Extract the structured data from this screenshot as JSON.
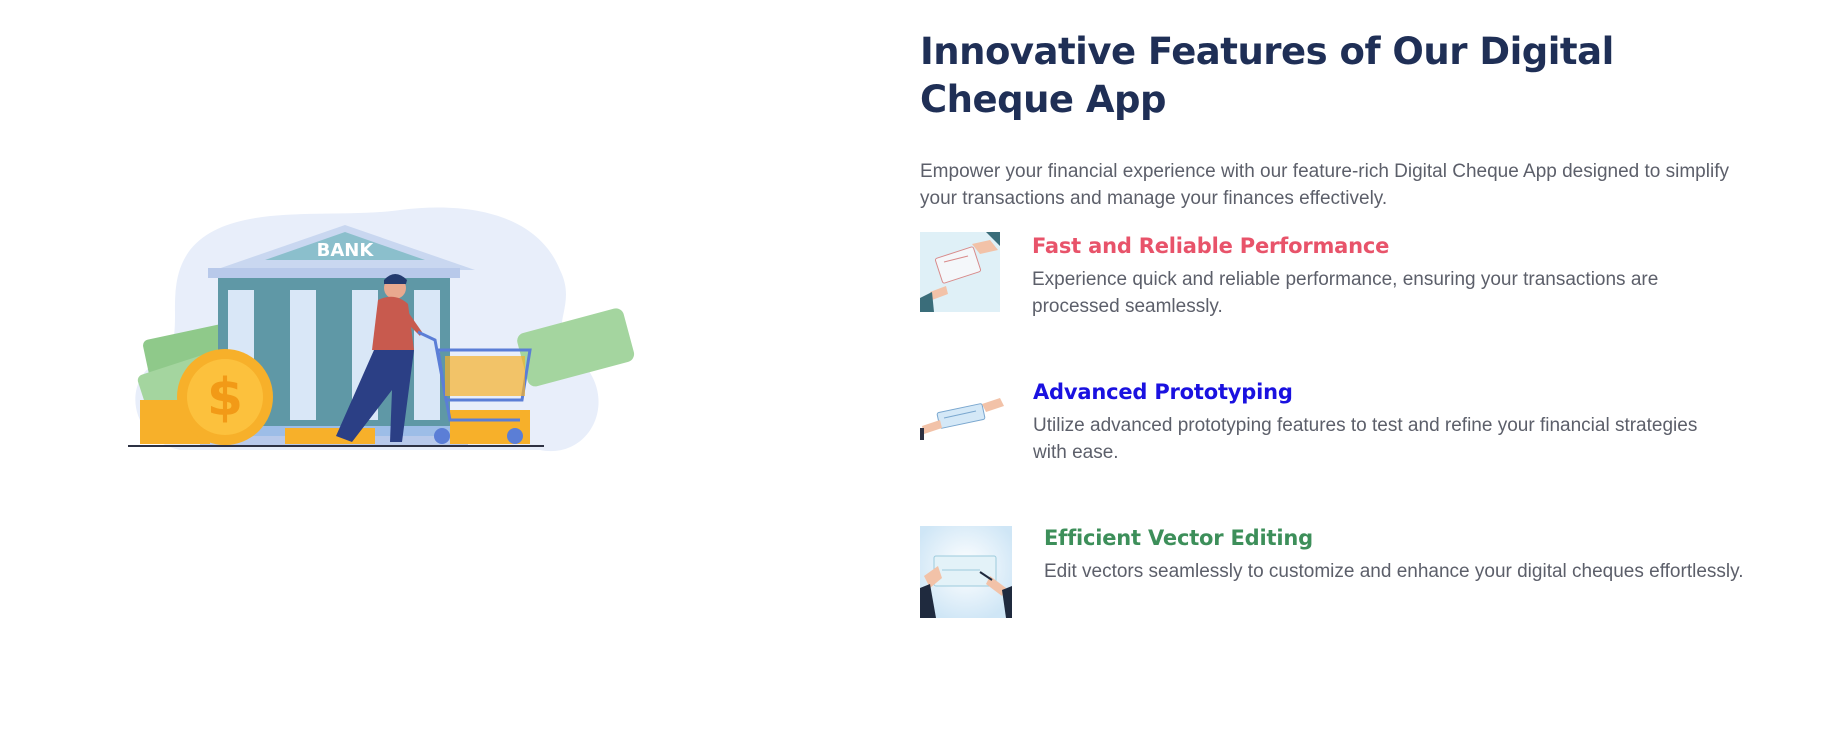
{
  "section": {
    "title": "Innovative Features of Our Digital Cheque App",
    "intro": "Empower your financial experience with our feature-rich Digital Cheque App designed to simplify your transactions and manage your finances effectively."
  },
  "illustration": {
    "bank_sign": "BANK",
    "icon": "bank-illustration"
  },
  "features": [
    {
      "title": "Fast and Reliable Performance",
      "description": "Experience quick and reliable performance, ensuring your transactions are processed seamlessly.",
      "color": "#e8536a",
      "icon": "cheque-handover-icon"
    },
    {
      "title": "Advanced Prototyping",
      "description": "Utilize advanced prototyping features to test and refine your financial strategies with ease.",
      "color": "#1a11e0",
      "icon": "cheque-exchange-icon"
    },
    {
      "title": "Efficient Vector Editing",
      "description": "Edit vectors seamlessly to customize and enhance your digital cheques effortlessly.",
      "color": "#3d8f5a",
      "icon": "cheque-signing-icon"
    }
  ],
  "colors": {
    "heading": "#1f2f56",
    "body_text": "#5c5f6a"
  }
}
